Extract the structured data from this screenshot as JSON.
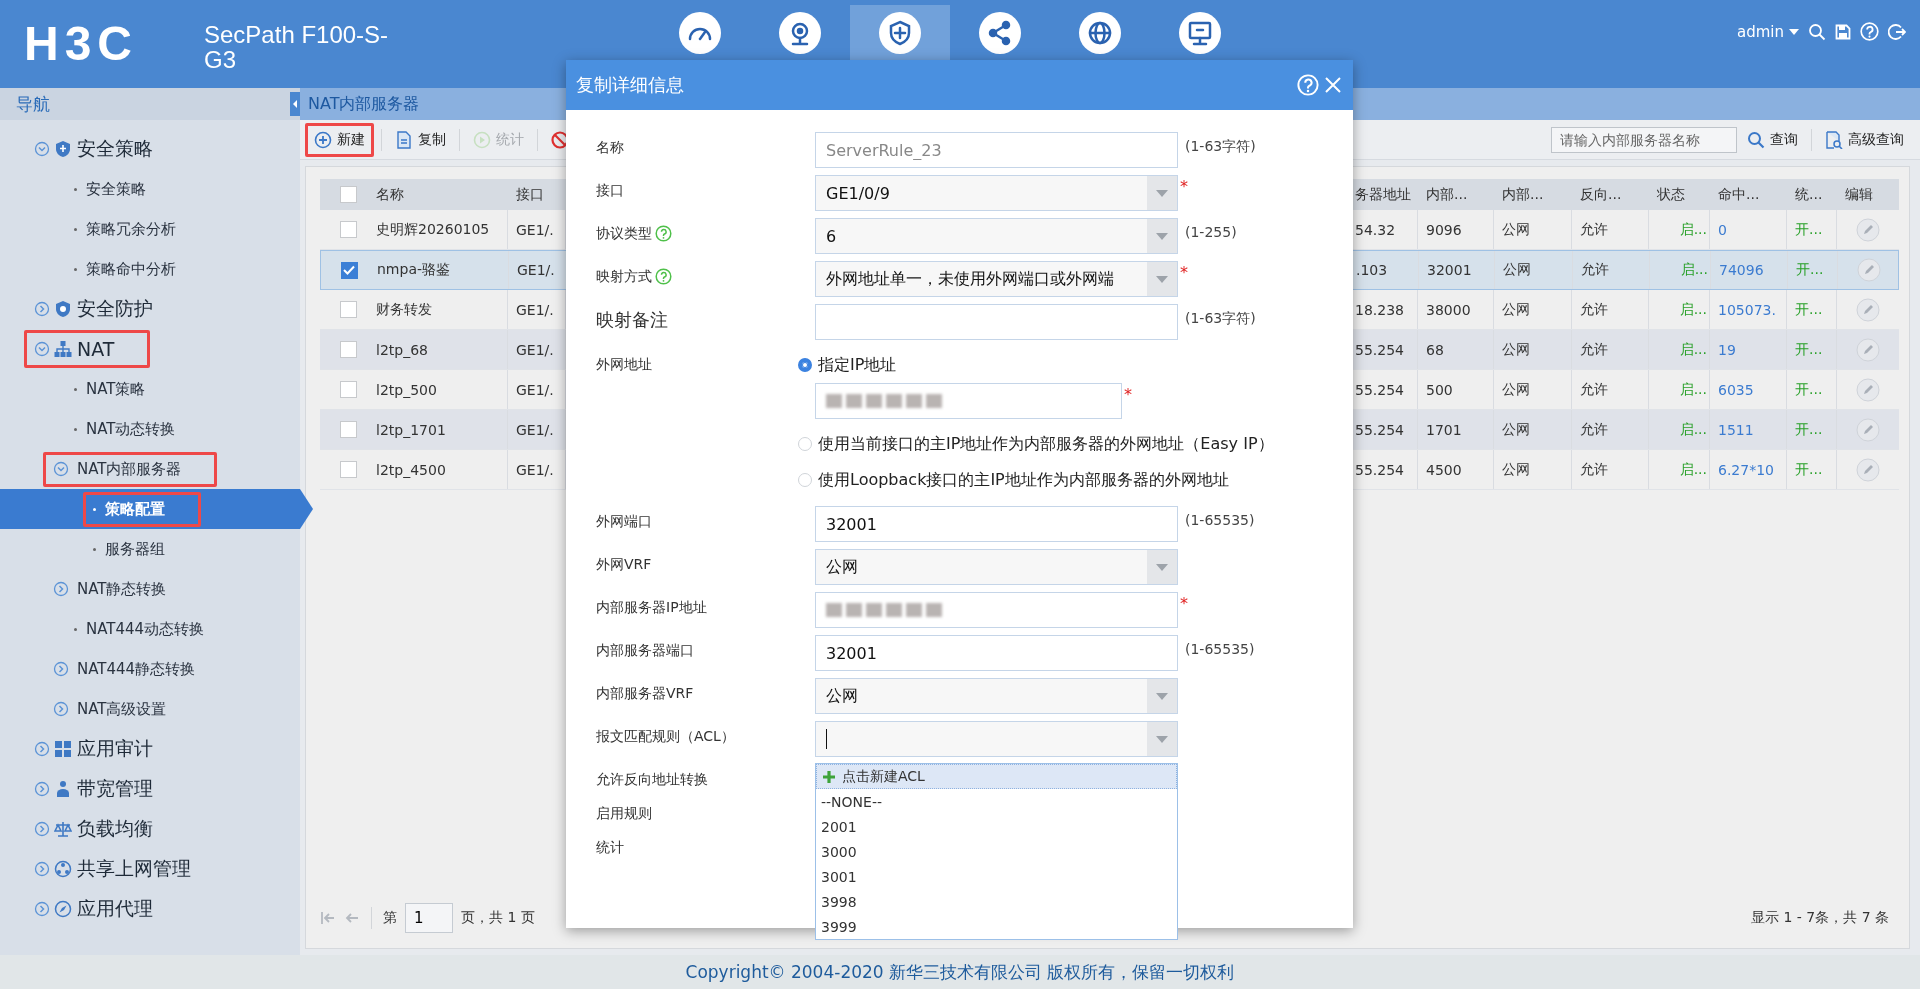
{
  "header": {
    "logo": "H3C",
    "product": "SecPath F100-S-G3",
    "modules": [
      {
        "selected": false
      },
      {
        "selected": false
      },
      {
        "selected": true
      },
      {
        "selected": false
      },
      {
        "selected": false
      },
      {
        "selected": false
      }
    ],
    "user": "admin"
  },
  "sidebar": {
    "title": "导航",
    "items": [
      {
        "label": "安全策略",
        "expanded": true,
        "selected": false,
        "marked": false,
        "children": [
          {
            "label": "安全策略",
            "selected": false,
            "marked": false
          },
          {
            "label": "策略冗余分析",
            "selected": false,
            "marked": false
          },
          {
            "label": "策略命中分析",
            "selected": false,
            "marked": false
          }
        ]
      },
      {
        "label": "安全防护",
        "expanded": false,
        "selected": false,
        "marked": false
      },
      {
        "label": "NAT",
        "expanded": true,
        "selected": false,
        "marked": true,
        "children": [
          {
            "label": "NAT策略",
            "selected": false,
            "marked": false
          },
          {
            "label": "NAT动态转换",
            "selected": false,
            "marked": false
          },
          {
            "label": "NAT内部服务器",
            "expanded": true,
            "selected": false,
            "marked": true,
            "children": [
              {
                "label": "策略配置",
                "selected": true,
                "marked": true
              },
              {
                "label": "服务器组",
                "selected": false,
                "marked": false
              }
            ]
          },
          {
            "label": "NAT静态转换",
            "expanded": false,
            "selected": false,
            "marked": false
          },
          {
            "label": "NAT444动态转换",
            "selected": false,
            "marked": false
          },
          {
            "label": "NAT444静态转换",
            "expanded": false,
            "selected": false,
            "marked": false
          },
          {
            "label": "NAT高级设置",
            "expanded": false,
            "selected": false,
            "marked": false
          }
        ]
      },
      {
        "label": "应用审计",
        "expanded": false,
        "selected": false,
        "marked": false
      },
      {
        "label": "带宽管理",
        "expanded": false,
        "selected": false,
        "marked": false
      },
      {
        "label": "负载均衡",
        "expanded": false,
        "selected": false,
        "marked": false
      },
      {
        "label": "共享上网管理",
        "expanded": false,
        "selected": false,
        "marked": false
      },
      {
        "label": "应用代理",
        "expanded": false,
        "selected": false,
        "marked": false
      }
    ]
  },
  "page_title": "NAT内部服务器",
  "toolbar": {
    "buttons": [
      {
        "label": "新建",
        "disabled": false,
        "marked": true
      },
      {
        "label": "复制",
        "disabled": false,
        "marked": false
      },
      {
        "label": "统计",
        "disabled": true,
        "marked": false
      },
      {
        "disabled": false,
        "marked": false
      }
    ],
    "search": {
      "placeholder": "请输入内部服务器名称"
    },
    "search_button": "查询",
    "advanced_button": "高级查询"
  },
  "table": {
    "all_checked": false,
    "columns_left": [
      "名称",
      "接口"
    ],
    "columns_right": [
      "务器地址",
      "内部...",
      "内部...",
      "反向...",
      "状态",
      "命中...",
      "统...",
      "编辑"
    ],
    "rows": [
      {
        "checked": false,
        "selected": false,
        "name": "史明辉20260105",
        "interface": "GE1/.",
        "server_address": "54.32",
        "port": "9096",
        "vrf": "公网",
        "reverse": "允许",
        "status": "启...",
        "hits": "0",
        "stats": "开..."
      },
      {
        "checked": true,
        "selected": true,
        "name": "nmpa-骆鉴",
        "interface": "GE1/.",
        "server_address": ".103",
        "port": "32001",
        "vrf": "公网",
        "reverse": "允许",
        "status": "启...",
        "hits": "74096",
        "stats": "开..."
      },
      {
        "checked": false,
        "selected": false,
        "name": "财务转发",
        "interface": "GE1/.",
        "server_address": "18.238",
        "port": "38000",
        "vrf": "公网",
        "reverse": "允许",
        "status": "启...",
        "hits": "105073.",
        "stats": "开..."
      },
      {
        "checked": false,
        "selected": false,
        "name": "l2tp_68",
        "interface": "GE1/.",
        "server_address": "55.254",
        "port": "68",
        "vrf": "公网",
        "reverse": "允许",
        "status": "启...",
        "hits": "19",
        "stats": "开..."
      },
      {
        "checked": false,
        "selected": false,
        "name": "l2tp_500",
        "interface": "GE1/.",
        "server_address": "55.254",
        "port": "500",
        "vrf": "公网",
        "reverse": "允许",
        "status": "启...",
        "hits": "6035",
        "stats": "开..."
      },
      {
        "checked": false,
        "selected": false,
        "name": "l2tp_1701",
        "interface": "GE1/.",
        "server_address": "55.254",
        "port": "1701",
        "vrf": "公网",
        "reverse": "允许",
        "status": "启...",
        "hits": "1511",
        "stats": "开..."
      },
      {
        "checked": false,
        "selected": false,
        "name": "l2tp_4500",
        "interface": "GE1/.",
        "server_address": "55.254",
        "port": "4500",
        "vrf": "公网",
        "reverse": "允许",
        "status": "启...",
        "hits": "6.27*10",
        "stats": "开..."
      }
    ]
  },
  "pager": {
    "prefix": "第",
    "page": "1",
    "suffix": "页，共 1 页",
    "summary": "显示 1 - 7条，共 7 条"
  },
  "dialog": {
    "title": "复制详细信息",
    "fields": [
      {
        "kind": "input",
        "label": "名称",
        "placeholder": "ServerRule_23",
        "hint": "(1-63字符)"
      },
      {
        "kind": "select",
        "label": "接口",
        "value": "GE1/0/9",
        "required_mark": "*"
      },
      {
        "kind": "select",
        "label": "协议类型",
        "help": true,
        "value": "6",
        "hint": "(1-255)"
      },
      {
        "kind": "select",
        "label": "映射方式",
        "help": true,
        "value": "外网地址单一，未使用外网端口或外网端",
        "required_mark": "*"
      },
      {
        "kind": "input",
        "label": "映射备注",
        "large": true,
        "hint": "(1-63字符)"
      },
      {
        "kind": "radios",
        "label": "外网地址",
        "options": [
          {
            "label": "指定IP地址",
            "selected": true,
            "redacted": true,
            "required_mark": "*"
          },
          {
            "label": "使用当前接口的主IP地址作为内部服务器的外网地址（Easy IP）",
            "selected": false
          },
          {
            "label": "使用Loopback接口的主IP地址作为内部服务器的外网地址",
            "selected": false
          }
        ]
      },
      {
        "kind": "input",
        "label": "外网端口",
        "value": "32001",
        "hint": "(1-65535)"
      },
      {
        "kind": "select",
        "label": "外网VRF",
        "value": "公网"
      },
      {
        "kind": "input",
        "label": "内部服务器IP地址",
        "redacted": true,
        "required_mark": "*"
      },
      {
        "kind": "input",
        "label": "内部服务器端口",
        "value": "32001",
        "hint": "(1-65535)"
      },
      {
        "kind": "select",
        "label": "内部服务器VRF",
        "value": "公网"
      },
      {
        "kind": "select",
        "label": "报文匹配规则（ACL）",
        "focused": true,
        "options": [
          {
            "label": "点击新建ACL",
            "kind": "action",
            "selected": true
          },
          {
            "label": "--NONE--",
            "kind": "option",
            "selected": false
          },
          {
            "label": "2001",
            "kind": "option",
            "selected": false
          },
          {
            "label": "3000",
            "kind": "option",
            "selected": false
          },
          {
            "label": "3001",
            "kind": "option",
            "selected": false
          },
          {
            "label": "3998",
            "kind": "option",
            "selected": false
          },
          {
            "label": "3999",
            "kind": "option",
            "selected": false
          }
        ]
      },
      {
        "kind": "none",
        "label": "允许反向地址转换"
      },
      {
        "kind": "none",
        "label": "启用规则"
      },
      {
        "kind": "none",
        "label": "统计"
      }
    ]
  },
  "footer": "Copyright© 2004-2020 新华三技术有限公司 版权所有，保留一切权利"
}
